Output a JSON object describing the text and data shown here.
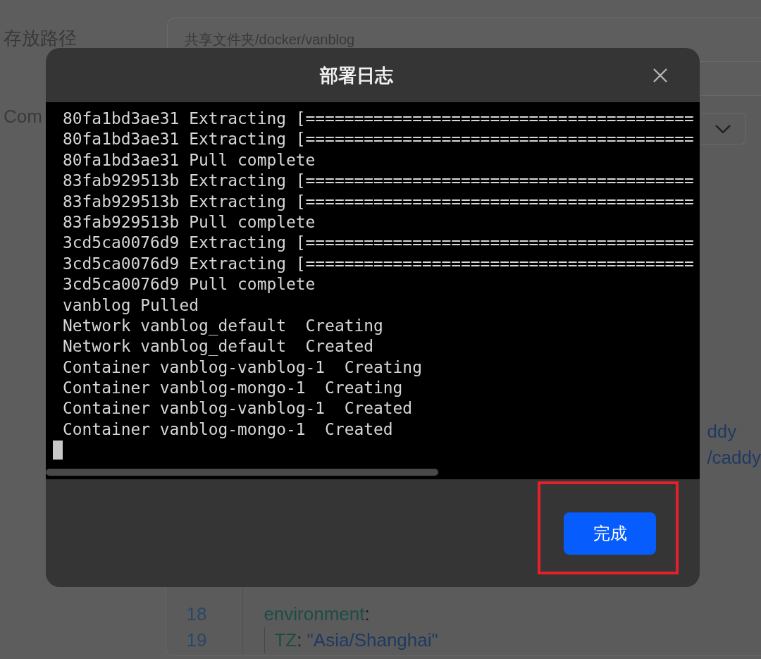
{
  "form": {
    "path_label": "存放路径",
    "path_value": "共享文件夹/docker/vanblog",
    "compose_label": "Com"
  },
  "editor": {
    "lines": [
      {
        "tokens": [
          {
            "kind": "string",
            "text": "ddy"
          }
        ]
      },
      {
        "tokens": [
          {
            "kind": "string",
            "text": "/caddy"
          }
        ]
      },
      {
        "number": "18",
        "tokens": [
          {
            "kind": "key",
            "text": "environment"
          },
          {
            "kind": "punct",
            "text": ":"
          }
        ],
        "children": [
          {
            "number": "19",
            "tokens": [
              {
                "kind": "key",
                "text": "TZ"
              },
              {
                "kind": "punct",
                "text": ": "
              },
              {
                "kind": "string",
                "text": "\"Asia/Shanghai\""
              }
            ]
          }
        ]
      }
    ]
  },
  "dialog": {
    "title": "部署日志",
    "terminal": {
      "lines": [
        "80fa1bd3ae31 Extracting [========================================",
        "80fa1bd3ae31 Extracting [========================================",
        "80fa1bd3ae31 Pull complete",
        "83fab929513b Extracting [========================================",
        "83fab929513b Extracting [========================================",
        "83fab929513b Pull complete",
        "3cd5ca0076d9 Extracting [========================================",
        "3cd5ca0076d9 Extracting [========================================",
        "3cd5ca0076d9 Pull complete",
        "vanblog Pulled",
        "Network vanblog_default  Creating",
        "Network vanblog_default  Created",
        "Container vanblog-vanblog-1  Creating",
        "Container vanblog-mongo-1  Creating",
        "Container vanblog-vanblog-1  Created",
        "Container vanblog-mongo-1  Created"
      ],
      "cursor": true
    },
    "buttons": [
      {
        "label": "完成",
        "kind": "primary"
      }
    ]
  }
}
